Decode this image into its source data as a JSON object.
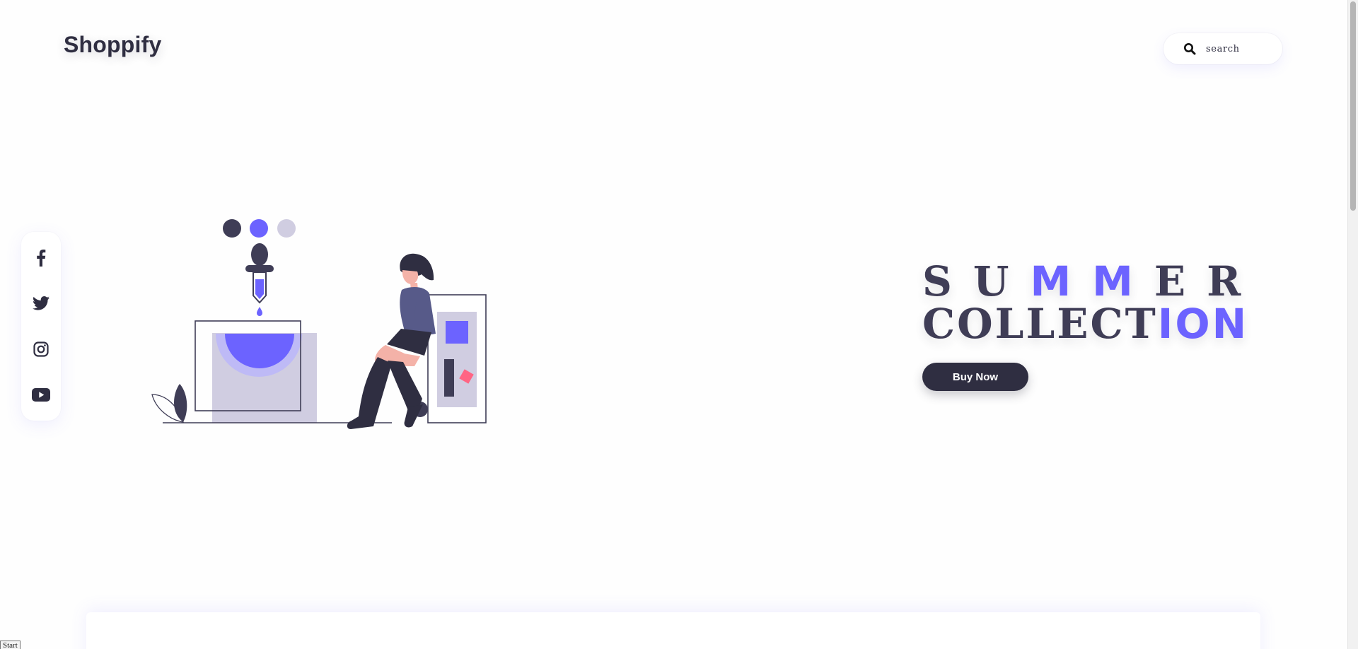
{
  "header": {
    "logo": "Shoppify",
    "search": {
      "placeholder": "search",
      "icon": "search-icon"
    }
  },
  "social": [
    {
      "name": "facebook",
      "icon": "facebook-icon"
    },
    {
      "name": "twitter",
      "icon": "twitter-icon"
    },
    {
      "name": "instagram",
      "icon": "instagram-icon"
    },
    {
      "name": "youtube",
      "icon": "youtube-icon"
    }
  ],
  "hero": {
    "line1_start": "SU",
    "line1_accent": "MM",
    "line1_end": "ER",
    "line2_start": "COLLECT",
    "line2_accent": "ION",
    "button_label": "Buy Now"
  },
  "status": {
    "start_label": "Start"
  },
  "colors": {
    "primary": "#2f2e41",
    "accent": "#6c63ff",
    "light": "#d0cde1",
    "pink": "#ff6584"
  }
}
